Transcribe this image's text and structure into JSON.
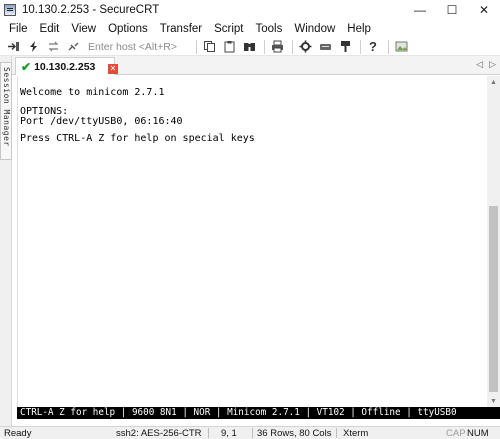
{
  "window": {
    "title": "10.130.2.253 - SecureCRT",
    "controls": {
      "minimize": "—",
      "maximize": "☐",
      "close": "✕"
    }
  },
  "menu": [
    "File",
    "Edit",
    "View",
    "Options",
    "Transfer",
    "Script",
    "Tools",
    "Window",
    "Help"
  ],
  "toolbar": {
    "host_placeholder": "Enter host <Alt+R>",
    "icons": [
      "connect-icon",
      "quick-connect-icon",
      "reconnect-icon",
      "disconnect-icon",
      "copy-icon",
      "paste-icon",
      "find-icon",
      "print-icon",
      "session-options-icon",
      "global-options-icon",
      "keymap-icon",
      "help-icon",
      "image-icon"
    ]
  },
  "session_manager": {
    "label": "Session Manager"
  },
  "tabs": [
    {
      "label": "10.130.2.253",
      "status_color": "#1c9b2c"
    }
  ],
  "terminal": {
    "lines": [
      "Welcome to minicom 2.7.1",
      "",
      "OPTIONS:",
      "Port /dev/ttyUSB0, 06:16:40",
      "",
      "Press CTRL-A Z for help on special keys"
    ],
    "status_line": "CTRL-A Z for help | 9600 8N1 | NOR | Minicom 2.7.1 | VT102 | Offline | ttyUSB0"
  },
  "statusbar": {
    "ready": "Ready",
    "cipher": "ssh2: AES-256-CTR",
    "position": "9,  1",
    "size": "36 Rows, 80 Cols",
    "emulation": "Xterm",
    "caps": "CAP",
    "num": "NUM"
  }
}
